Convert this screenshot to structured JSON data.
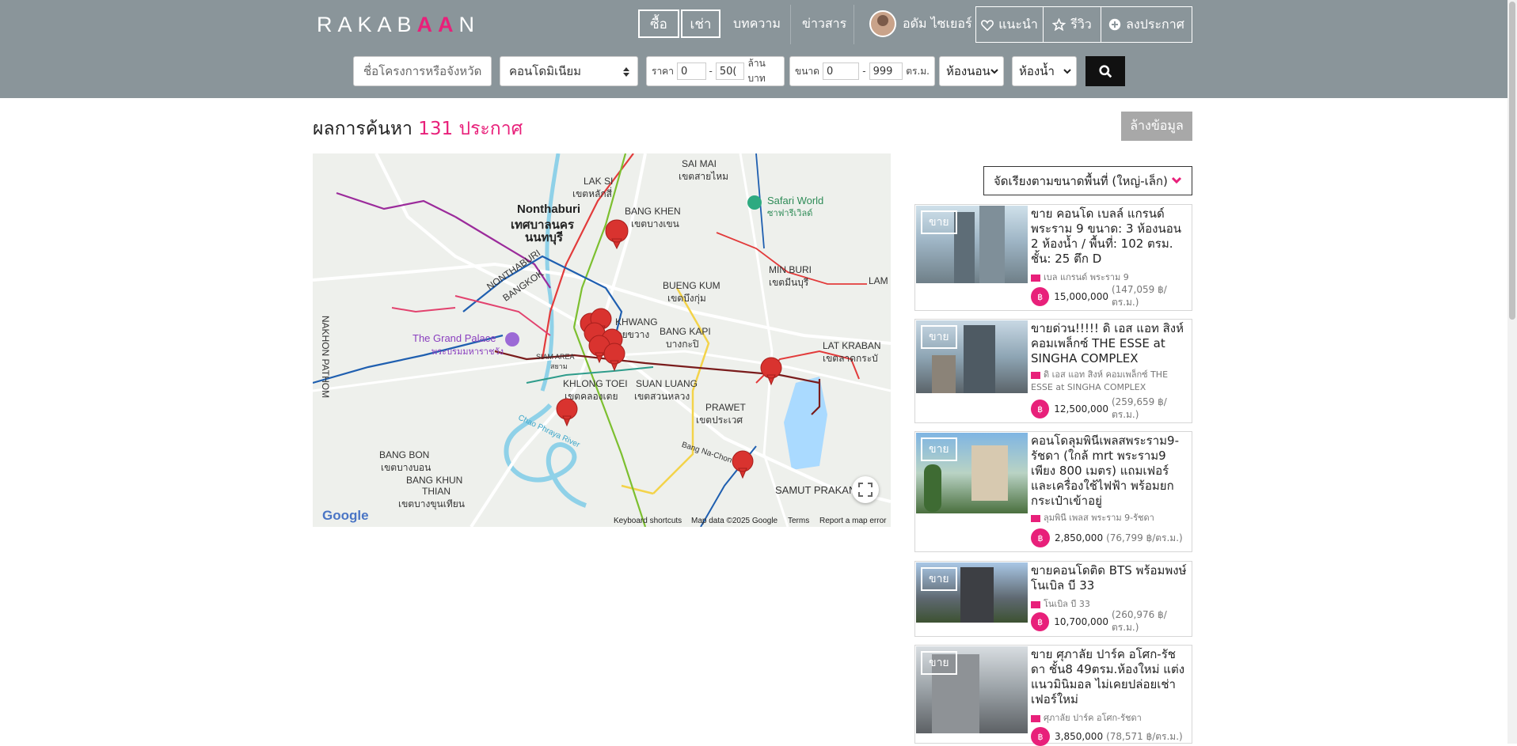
{
  "brand": {
    "logo_left": "RAKAB",
    "logo_mid": "AA",
    "logo_right": "N"
  },
  "nav": {
    "buy": "ซื้อ",
    "rent": "เช่า",
    "articles": "บทความ",
    "news": "ข่าวสาร",
    "user_name": "อดัม ไซเยอร์",
    "recommend": "แนะนำ",
    "review": "รีวิว",
    "post": "ลงประกาศ"
  },
  "search": {
    "keyword_placeholder": "ชื่อโครงการหรือจังหวัด",
    "property_type": "คอนโดมิเนียม",
    "price_label": "ราคา",
    "price_min": "0",
    "price_max": "50(",
    "price_unit": "ล้านบาท",
    "size_label": "ขนาด",
    "size_min": "0",
    "size_max": "999",
    "size_unit": "ตร.ม.",
    "bedroom": "ห้องนอน",
    "bathroom": "ห้องน้ำ",
    "dash": "-"
  },
  "results": {
    "prefix": "ผลการค้นหา",
    "count": "131 ประกาศ",
    "clear": "ล้างข้อมูล"
  },
  "sort": {
    "label": "จัดเรียงตามขนาดพื้นที่ (ใหญ่-เล็ก)"
  },
  "map": {
    "labels": {
      "nonthaburi": "Nonthaburi",
      "nonthaburi_th": "เทศบาลนคร",
      "nonthaburi_th2": "นนทบุรี",
      "grand_palace": "The Grand Palace",
      "grand_palace_th": "พระบรมมหาราชวัง",
      "safari": "Safari World",
      "safari_th": "ซาฟารีเวิลด์",
      "lak_si": "LAK SI",
      "lak_si_th": "เขตหลักสี่",
      "bang_khen": "BANG KHEN",
      "bang_khen_th": "เขตบางเขน",
      "sai_mai": "SAI MAI",
      "sai_mai_th": "เขตสายไหม",
      "min_buri": "MIN BURI",
      "min_buri_th": "เขตมีนบุรี",
      "bueng_kum": "BUENG KUM",
      "bueng_kum_th": "เขตบึงกุ่ม",
      "huai_khwang": "KHWANG",
      "huai_khwang_th": "ห้วยขวาง",
      "bang_kapi": "BANG KAPI",
      "bang_kapi_th": "บางกะปิ",
      "lat_krabang": "LAT KRABAN",
      "lat_krabang_th": "เขตลาดกระบั",
      "khlong_toei": "KHLONG TOEI",
      "khlong_toei_th": "เขตคลองเตย",
      "suan_luang": "SUAN LUANG",
      "suan_luang_th": "เขตสวนหลวง",
      "prawet": "PRAWET",
      "prawet_th": "เขตประเวศ",
      "bang_bon": "BANG BON",
      "bang_bon_th": "เขตบางบอน",
      "bang_khun_thian": "BANG KHUN",
      "bang_khun_thian2": "THIAN",
      "bang_khun_thian_th": "เขตบางขุนเทียน",
      "samut_prakan": "SAMUT PRAKAN",
      "bangkok": "BANGKOK",
      "nonthaburi_road": "NONTHABURI",
      "nakhon_pathom": "NAKHON PATHOM",
      "siam": "SIAM AREA",
      "siam_th": "สยาม",
      "chao_phraya": "Chao Phraya River",
      "bang_na": "Bang Na-Chon Buri",
      "lam": "LAM"
    },
    "attribution": {
      "keyboard": "Keyboard shortcuts",
      "data": "Map data ©2025 Google",
      "terms": "Terms",
      "report": "Report a map error",
      "logo": "Google"
    }
  },
  "listings": [
    {
      "badge": "ขาย",
      "title": "ขาย คอนโด เบลล์ แกรนด์ พระราม 9 ขนาด: 3 ห้องนอน 2 ห้องน้ำ / พื้นที่: 102 ตรม. ชั้น: 25 ตึก D",
      "project": "เบล แกรนด์ พระราม 9",
      "price": "15,000,000",
      "per_sqm": "(147,059 ฿/ตร.ม.)"
    },
    {
      "badge": "ขาย",
      "title": "ขายด่วน!!!!! ดิ เอส แอท สิงห์ คอมเพล็กซ์ THE ESSE at SINGHA COMPLEX",
      "project": "ดิ เอส แอท สิงห์ คอมเพล็กซ์ THE ESSE at SINGHA COMPLEX",
      "price": "12,500,000",
      "per_sqm": "(259,659 ฿/ตร.ม.)"
    },
    {
      "badge": "ขาย",
      "title": "คอนโดลุมพินีเพลสพระราม9-รัชดา (ใกล้ mrt พระราม9 เพียง 800 เมตร) แถมเฟอร์และเครื่องใช้ไฟฟ้า พร้อมยกกระเป๋าเข้าอยู่",
      "project": "ลุมพินี เพลส พระราม 9-รัชดา",
      "price": "2,850,000",
      "per_sqm": "(76,799 ฿/ตร.ม.)"
    },
    {
      "badge": "ขาย",
      "title": "ขายคอนโดติด BTS พร้อมพงษ์ โนเบิล บี 33",
      "project": "โนเบิล บี 33",
      "price": "10,700,000",
      "per_sqm": "(260,976 ฿/ตร.ม.)"
    },
    {
      "badge": "ขาย",
      "title": "ขาย ศุภาลัย ปาร์ค อโศก-รัชดา ชั้น8 49ตรม.ห้องใหม่ แต่งแนวมินิมอล ไม่เคยปล่อยเช่า เฟอร์ใหม่",
      "project": "ศุภาลัย ปาร์ค อโศก-รัชดา",
      "price": "3,850,000",
      "per_sqm": "(78,571 ฿/ตร.ม.)"
    }
  ],
  "currency_symbol": "฿",
  "colors": {
    "header": "#8a959a",
    "accent": "#e8207a",
    "pin": "#d9332f"
  }
}
